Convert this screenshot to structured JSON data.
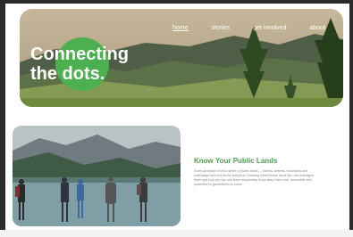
{
  "nav": {
    "items": [
      {
        "label": "home",
        "active": true
      },
      {
        "label": "stories",
        "active": false
      },
      {
        "label": "get involved",
        "active": false
      },
      {
        "label": "about",
        "active": false
      }
    ]
  },
  "hero": {
    "title_line1": "Connecting",
    "title_line2": "the dots.",
    "accent_color": "#4caf50"
  },
  "section": {
    "heading": "Know Your Public Lands",
    "body": "Every American owns a share of public lands — forests, deserts, mountains and waterways held in trust for everyone. Knowing where these lands are, who manages them and how you can use them responsibly helps keep them wild, accessible and protected for generations to come."
  },
  "colors": {
    "heading_green": "#4fa14f",
    "body_gray": "#7a8a7a"
  }
}
